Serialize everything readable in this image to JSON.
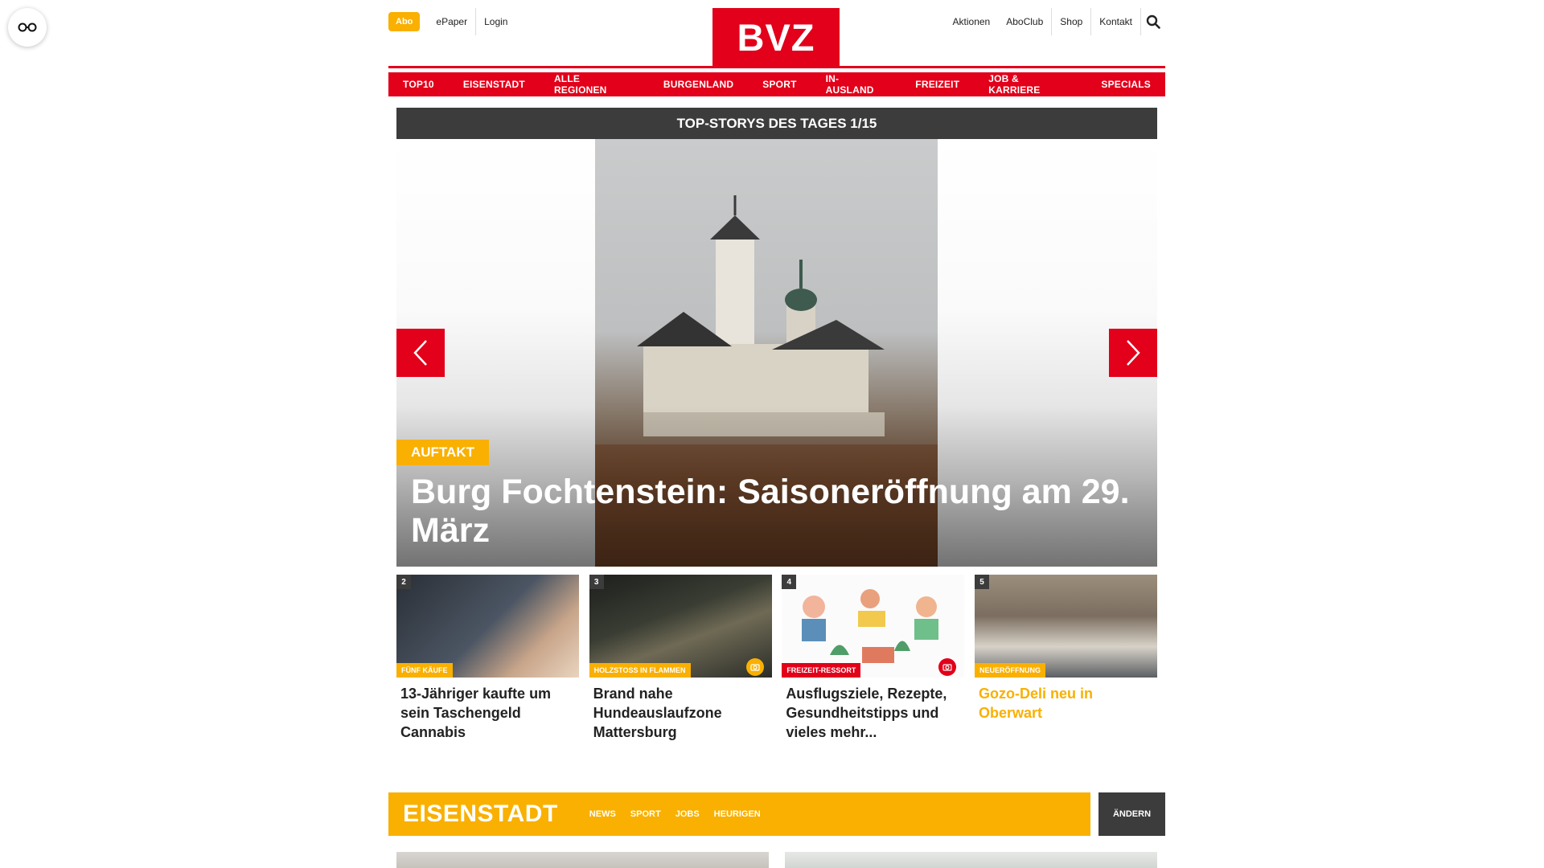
{
  "header": {
    "abo_label": "Abo",
    "epaper_label": "ePaper",
    "login_label": "Login",
    "logo_text": "BVZ",
    "right_links": [
      "Aktionen",
      "AboClub",
      "Shop",
      "Kontakt"
    ]
  },
  "nav": [
    "TOP10",
    "EISENSTADT",
    "ALLE REGIONEN",
    "BURGENLAND",
    "SPORT",
    "IN-AUSLAND",
    "FREIZEIT",
    "JOB & KARRIERE",
    "SPECIALS"
  ],
  "topstories": {
    "bar_label": "TOP-STORYS DES TAGES 1/15",
    "hero_tag": "AUFTAKT",
    "hero_title": "Burg Fochtenstein: Saisoneröffnung am 29. März"
  },
  "teasers": [
    {
      "num": "2",
      "tag": "FÜNF KÄUFE",
      "title": "13-Jähriger kaufte um sein Taschengeld Cannabis"
    },
    {
      "num": "3",
      "tag": "HOLZSTOSS IN FLAMMEN",
      "title": "Brand nahe Hundeauslaufzone Mattersburg"
    },
    {
      "num": "4",
      "tag": "FREIZEIT-RESSORT",
      "title": "Ausflugsziele, Rezepte, Gesundheitstipps und vieles mehr..."
    },
    {
      "num": "5",
      "tag": "NEUERÖFFNUNG",
      "title": "Gozo-Deli neu in Oberwart"
    }
  ],
  "region": {
    "title": "EISENSTADT",
    "links": [
      "NEWS",
      "SPORT",
      "JOBS",
      "HEURIGEN"
    ],
    "change_label": "ÄNDERN"
  },
  "colors": {
    "brand_red": "#e2001a",
    "accent_yellow": "#f9b000",
    "dark_bar": "#3c3c3c"
  }
}
